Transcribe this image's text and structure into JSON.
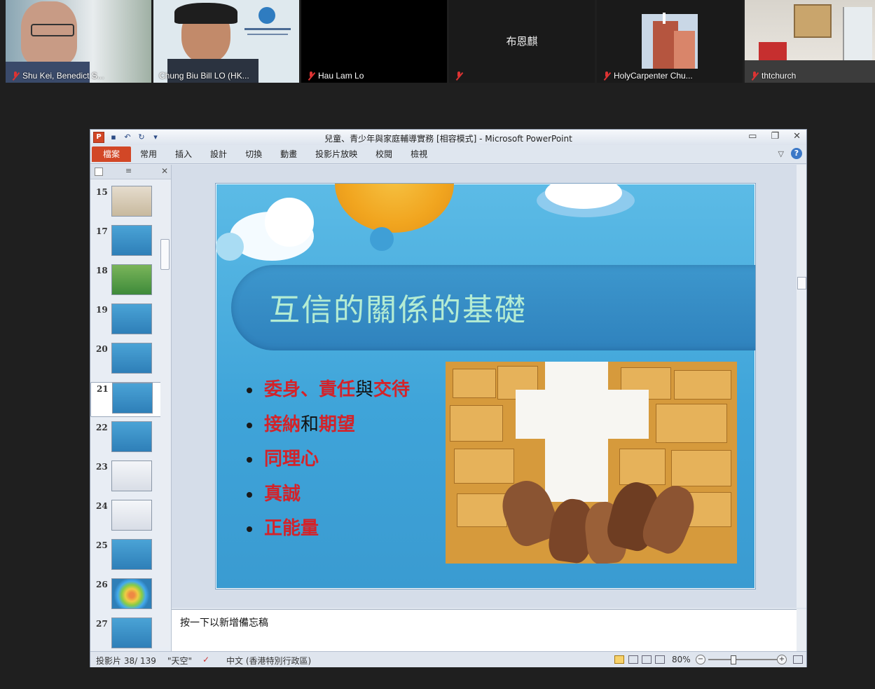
{
  "participants": [
    {
      "name": "Shu Kei, Benedict S...",
      "muted": true
    },
    {
      "name": "Chung Biu Bill LO (HK...",
      "muted": false,
      "active": true
    },
    {
      "name": "Hau Lam Lo",
      "muted": true
    },
    {
      "name": "",
      "muted": true,
      "center_label": "布恩麒"
    },
    {
      "name": "HolyCarpenter Chu...",
      "muted": true
    },
    {
      "name": "thtchurch",
      "muted": true
    }
  ],
  "window": {
    "title": "兒童、青少年與家庭輔導實務 [相容模式] - Microsoft PowerPoint",
    "app_icon": "P"
  },
  "ribbon": {
    "tabs": [
      "檔案",
      "常用",
      "插入",
      "設計",
      "切換",
      "動畫",
      "投影片放映",
      "校閱",
      "檢視"
    ]
  },
  "thumbnails": [
    {
      "num": "15",
      "style": "warm"
    },
    {
      "num": "17",
      "style": "blue"
    },
    {
      "num": "18",
      "style": "green"
    },
    {
      "num": "19",
      "style": "blue"
    },
    {
      "num": "20",
      "style": "blue"
    },
    {
      "num": "21",
      "style": "blue",
      "selected": true
    },
    {
      "num": "22",
      "style": "blue"
    },
    {
      "num": "23",
      "style": "white"
    },
    {
      "num": "24",
      "style": "white"
    },
    {
      "num": "25",
      "style": "blue"
    },
    {
      "num": "26",
      "style": "ring"
    },
    {
      "num": "27",
      "style": "blue"
    }
  ],
  "slide": {
    "title": "互信的關係的基礎",
    "bullets": [
      [
        {
          "text": "委身、責任",
          "red": true
        },
        {
          "text": "與",
          "red": false
        },
        {
          "text": "交待",
          "red": true
        }
      ],
      [
        {
          "text": "接納",
          "red": true
        },
        {
          "text": "和",
          "red": false
        },
        {
          "text": "期望",
          "red": true
        }
      ],
      [
        {
          "text": "同理心",
          "red": true
        }
      ],
      [
        {
          "text": "真誠",
          "red": true
        }
      ],
      [
        {
          "text": "正能量",
          "red": true
        }
      ]
    ]
  },
  "notes": {
    "placeholder": "按一下以新增備忘稿"
  },
  "status": {
    "slide_counter": "投影片 38/ 139",
    "theme": "\"天空\"",
    "language": "中文 (香港特別行政區)",
    "zoom": "80%"
  },
  "colors": {
    "bullet_red": "#d3232a",
    "title_mint": "#b4ecd3",
    "file_tab": "#d24726"
  }
}
